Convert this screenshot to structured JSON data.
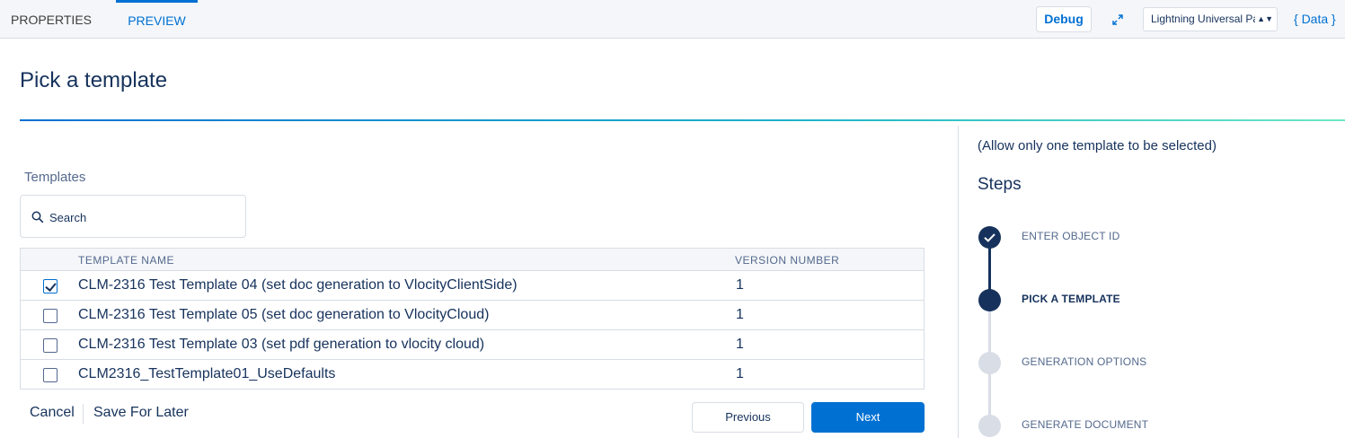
{
  "topbar": {
    "tabs": [
      {
        "label": "PROPERTIES"
      },
      {
        "label": "PREVIEW"
      }
    ],
    "debug_label": "Debug",
    "page_select_value": "Lightning Universal Page",
    "data_link": "{ Data }"
  },
  "main": {
    "title": "Pick a template",
    "templates_label": "Templates",
    "search_placeholder": "Search",
    "table": {
      "columns": [
        "TEMPLATE NAME",
        "VERSION NUMBER"
      ],
      "rows": [
        {
          "name": "CLM-2316 Test Template 04 (set doc generation to VlocityClientSide)",
          "version": "1",
          "checked": true
        },
        {
          "name": "CLM-2316 Test Template 05 (set doc generation to VlocityCloud)",
          "version": "1",
          "checked": false
        },
        {
          "name": "CLM-2316 Test Template 03 (set pdf generation to vlocity cloud)",
          "version": "1",
          "checked": false
        },
        {
          "name": "CLM2316_TestTemplate01_UseDefaults",
          "version": "1",
          "checked": false
        }
      ]
    },
    "footer": {
      "cancel": "Cancel",
      "save_for_later": "Save For Later",
      "previous": "Previous",
      "next": "Next"
    }
  },
  "sidebar": {
    "note": "(Allow only one template to be selected)",
    "steps_title": "Steps",
    "steps": [
      {
        "label": "ENTER OBJECT ID",
        "status": "complete"
      },
      {
        "label": "PICK A TEMPLATE",
        "status": "current"
      },
      {
        "label": "GENERATION OPTIONS",
        "status": "pending"
      },
      {
        "label": "GENERATE DOCUMENT",
        "status": "pending"
      }
    ]
  },
  "colors": {
    "brand": "#0070d2",
    "navy": "#16325c",
    "border": "#d8dde6"
  }
}
